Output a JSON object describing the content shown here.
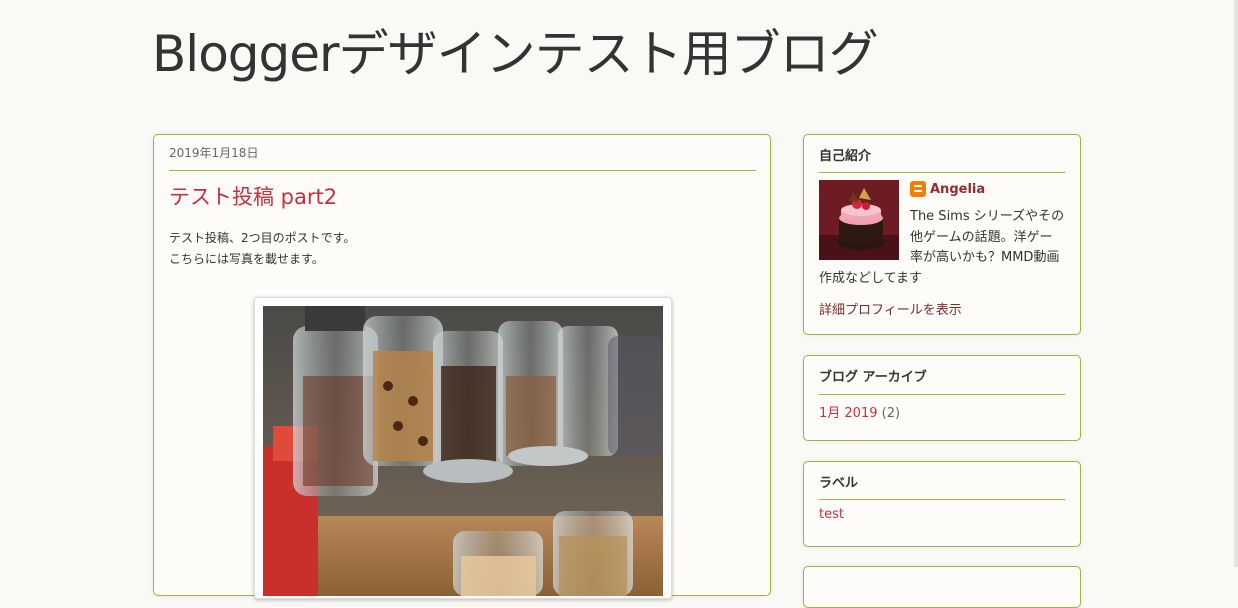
{
  "blog": {
    "title": "Bloggerデザインテスト用ブログ"
  },
  "post": {
    "date": "2019年1月18日",
    "title": "テスト投稿 part2",
    "body": [
      "テスト投稿、2つ目のポストです。",
      "こちらには写真を載せます。"
    ]
  },
  "sidebar": {
    "profile": {
      "heading": "自己紹介",
      "name": "Angelia",
      "about": "The Sims シリーズやその他ゲームの話題。洋ゲー率が高いかも？MMD動画作成などしてます",
      "link": "詳細プロフィールを表示"
    },
    "archive": {
      "heading": "ブログ アーカイブ",
      "items": [
        {
          "label": "1月 2019",
          "count": "(2)"
        }
      ]
    },
    "labels": {
      "heading": "ラベル",
      "items": [
        {
          "label": "test"
        }
      ]
    }
  },
  "colors": {
    "accent": "#9fb33c",
    "link": "#c5303b",
    "background": "#faf9f5",
    "blogger_icon": "#f57d00"
  },
  "icons": {
    "profile_badge": "blogger-icon"
  }
}
